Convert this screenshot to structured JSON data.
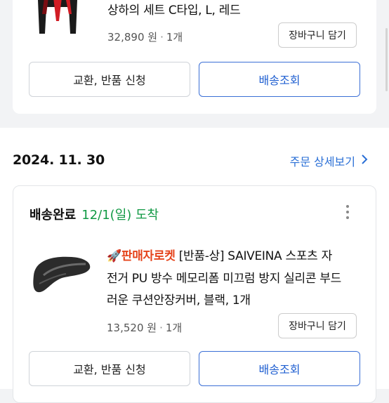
{
  "order1": {
    "product_title": "상하의 세트 C타입, L, 레드",
    "price": "32,890 원",
    "qty": "1개",
    "cart_label": "장바구니 담기",
    "exchange_label": "교환, 반품 신청",
    "tracking_label": "배송조회"
  },
  "order2": {
    "date": "2024. 11. 30",
    "detail_link": "주문 상세보기",
    "status": "배송완료",
    "arrival": "12/1(일) 도착",
    "badge": "판매자로켓",
    "title_line1_rest": "[반품-상] SAIVEINA 스포츠 자",
    "title_line2": "전거 PU 방수 메모리폼 미끄럼 방지 실리콘 부드",
    "title_line3": "러운 쿠션안장커버, 블랙, 1개",
    "price": "13,520 원",
    "qty": "1개",
    "cart_label": "장바구니 담기",
    "exchange_label": "교환, 반품 신청",
    "tracking_label": "배송조회"
  },
  "icons": [
    "jacket-thumbnail",
    "rocket-icon",
    "saddle-thumbnail",
    "chevron-right-icon",
    "more-vertical-icon"
  ],
  "colors": {
    "link_blue": "#2a6fd6",
    "arrival_green": "#119944",
    "badge_red": "#e5441c"
  }
}
